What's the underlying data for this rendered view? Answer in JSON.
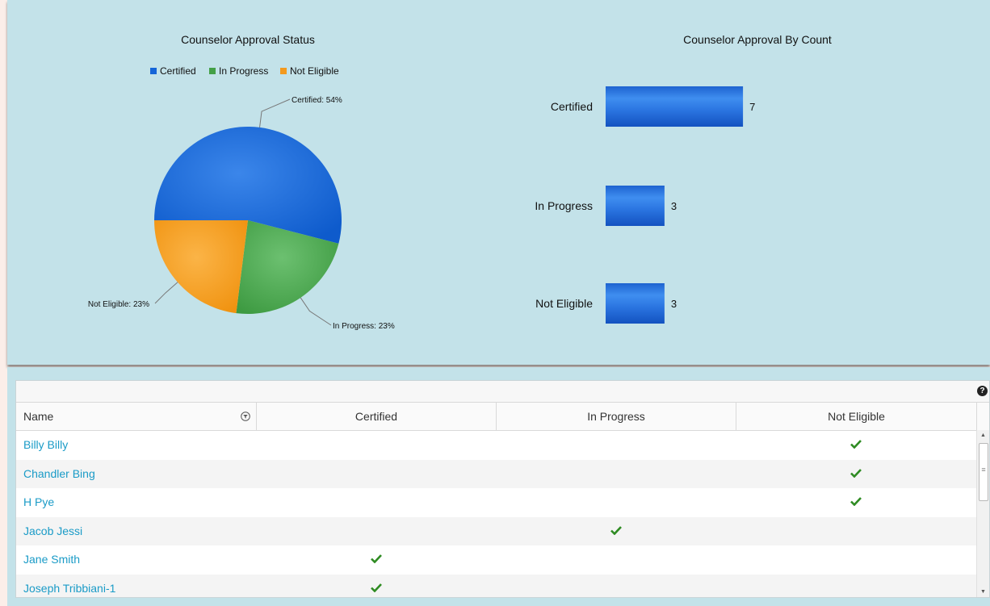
{
  "colors": {
    "certified": "#1565d8",
    "in_progress": "#43a047",
    "not_eligible": "#f39a1e",
    "panel": "#c3e2e9",
    "link": "#1a9bc7",
    "check": "#2e8b22"
  },
  "chart_data": [
    {
      "type": "pie",
      "title": "Counselor Approval Status",
      "legend_position": "top",
      "labels": [
        "Certified",
        "In Progress",
        "Not Eligible"
      ],
      "values": [
        54,
        23,
        23
      ],
      "data_labels": [
        "Certified: 54%",
        "In Progress: 23%",
        "Not Eligible: 23%"
      ]
    },
    {
      "type": "bar",
      "orientation": "horizontal",
      "title": "Counselor Approval By Count",
      "categories": [
        "Certified",
        "In Progress",
        "Not Eligible"
      ],
      "values": [
        7,
        3,
        3
      ],
      "xlim": [
        0,
        8
      ]
    }
  ],
  "grid": {
    "help_icon": "help-icon",
    "columns": [
      "Name",
      "Certified",
      "In Progress",
      "Not Eligible"
    ],
    "filter_icon": "filter-icon",
    "rows": [
      {
        "name": "Billy Billy",
        "status": "Not Eligible"
      },
      {
        "name": "Chandler Bing",
        "status": "Not Eligible"
      },
      {
        "name": "H Pye",
        "status": "Not Eligible"
      },
      {
        "name": "Jacob Jessi",
        "status": "In Progress"
      },
      {
        "name": "Jane Smith",
        "status": "Certified"
      },
      {
        "name": "Joseph Tribbiani-1",
        "status": "Certified"
      }
    ]
  }
}
